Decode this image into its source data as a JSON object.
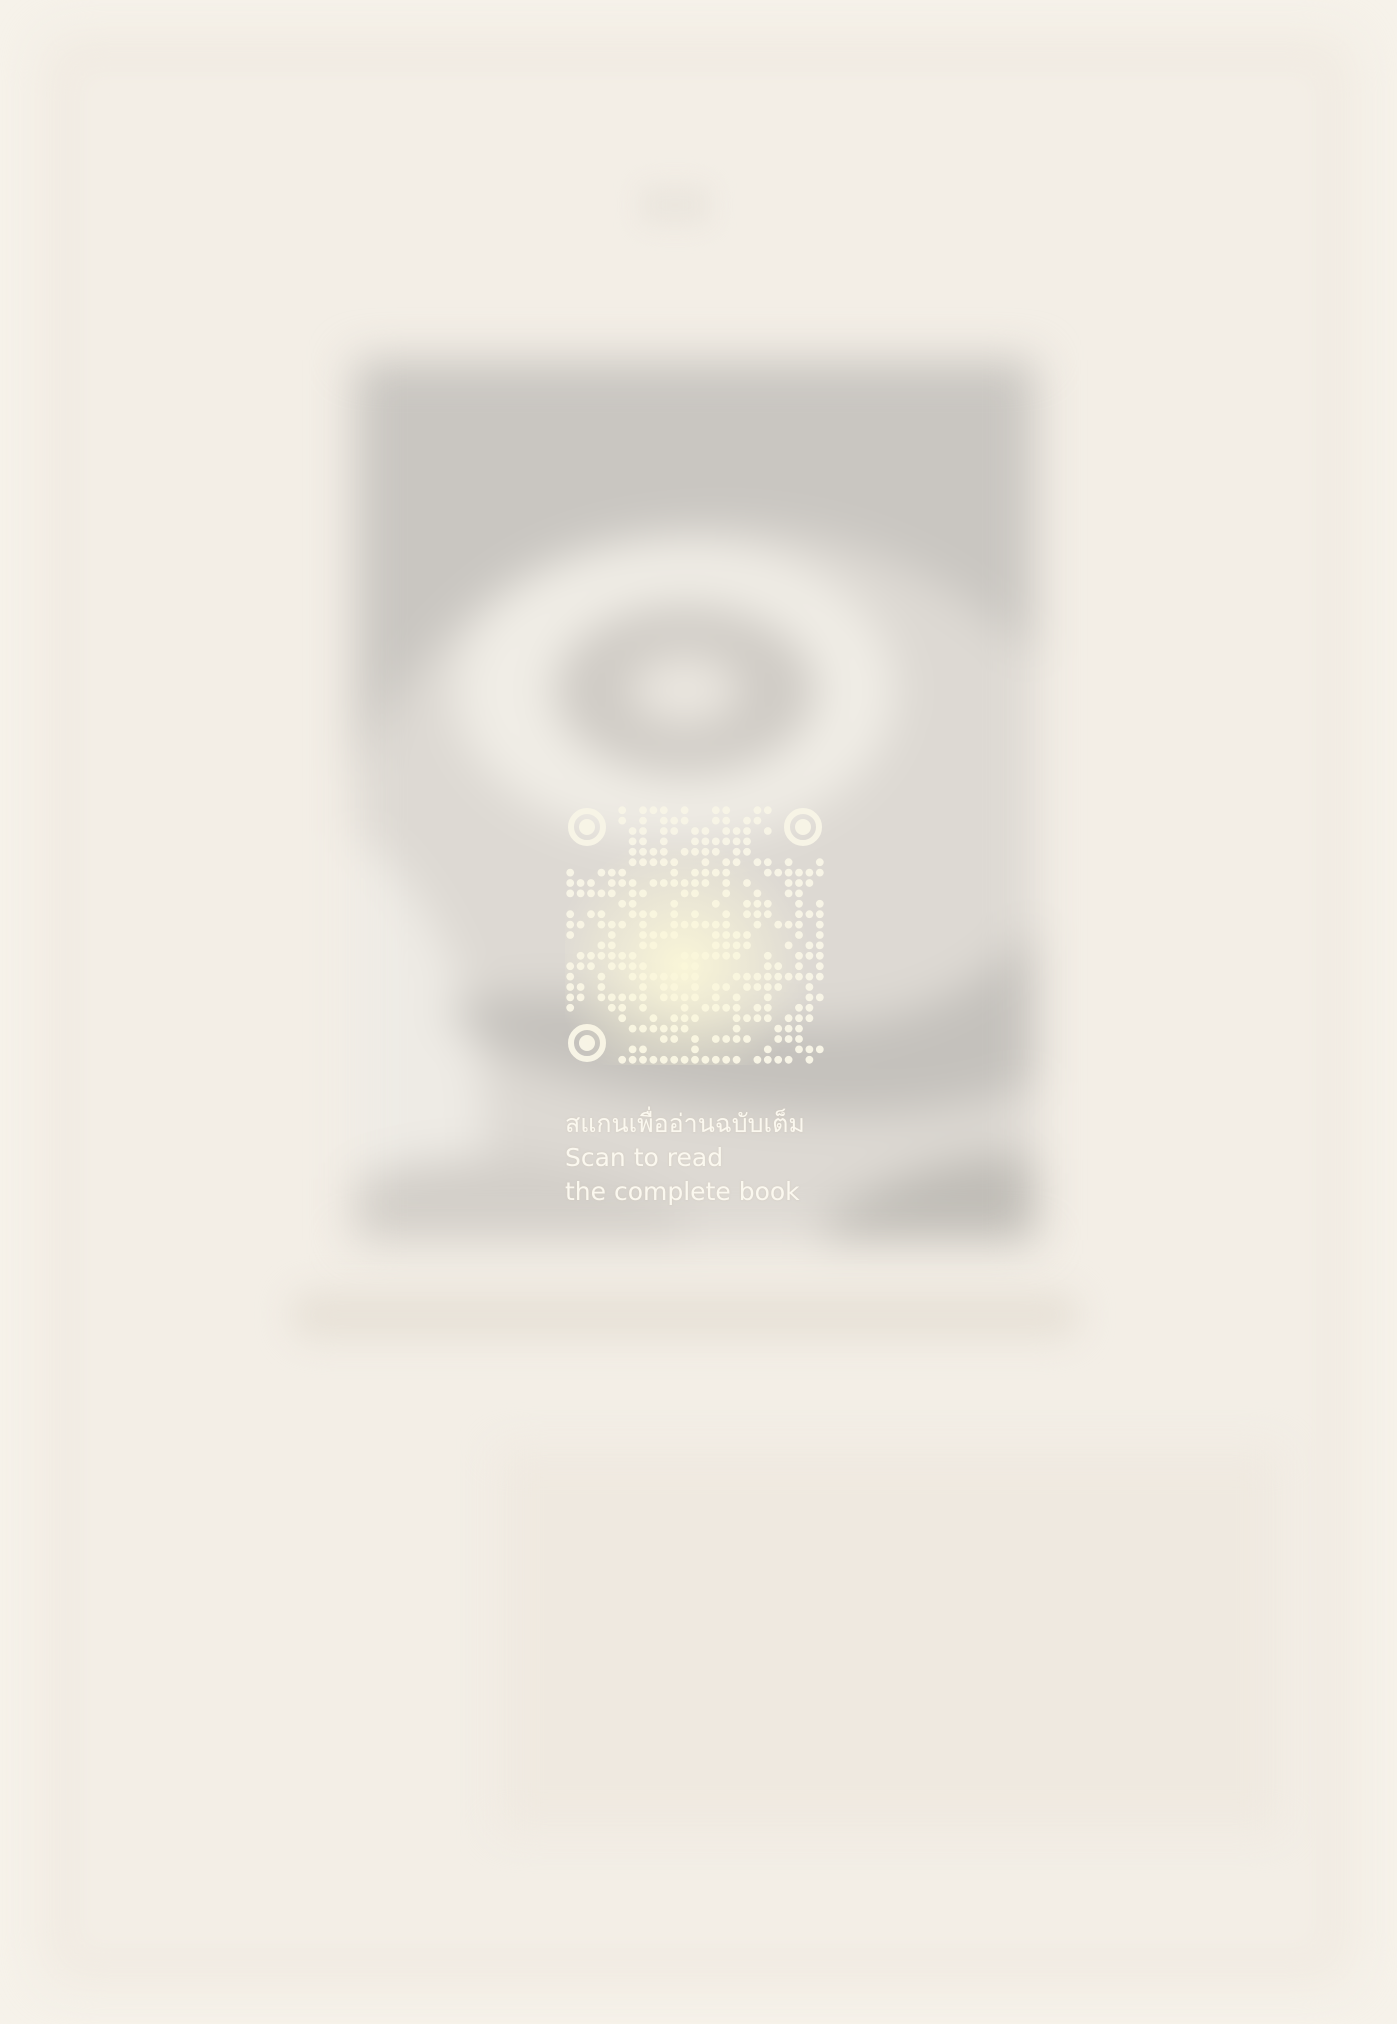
{
  "overlay": {
    "qr_icon": "qr-code-icon",
    "lines": [
      "สแกนเพื่ออ่านฉบับเต็ม",
      "Scan to read",
      "the complete book"
    ]
  },
  "colors": {
    "background": "#f6f2ea",
    "overlay_text": "#fbf8ef"
  }
}
